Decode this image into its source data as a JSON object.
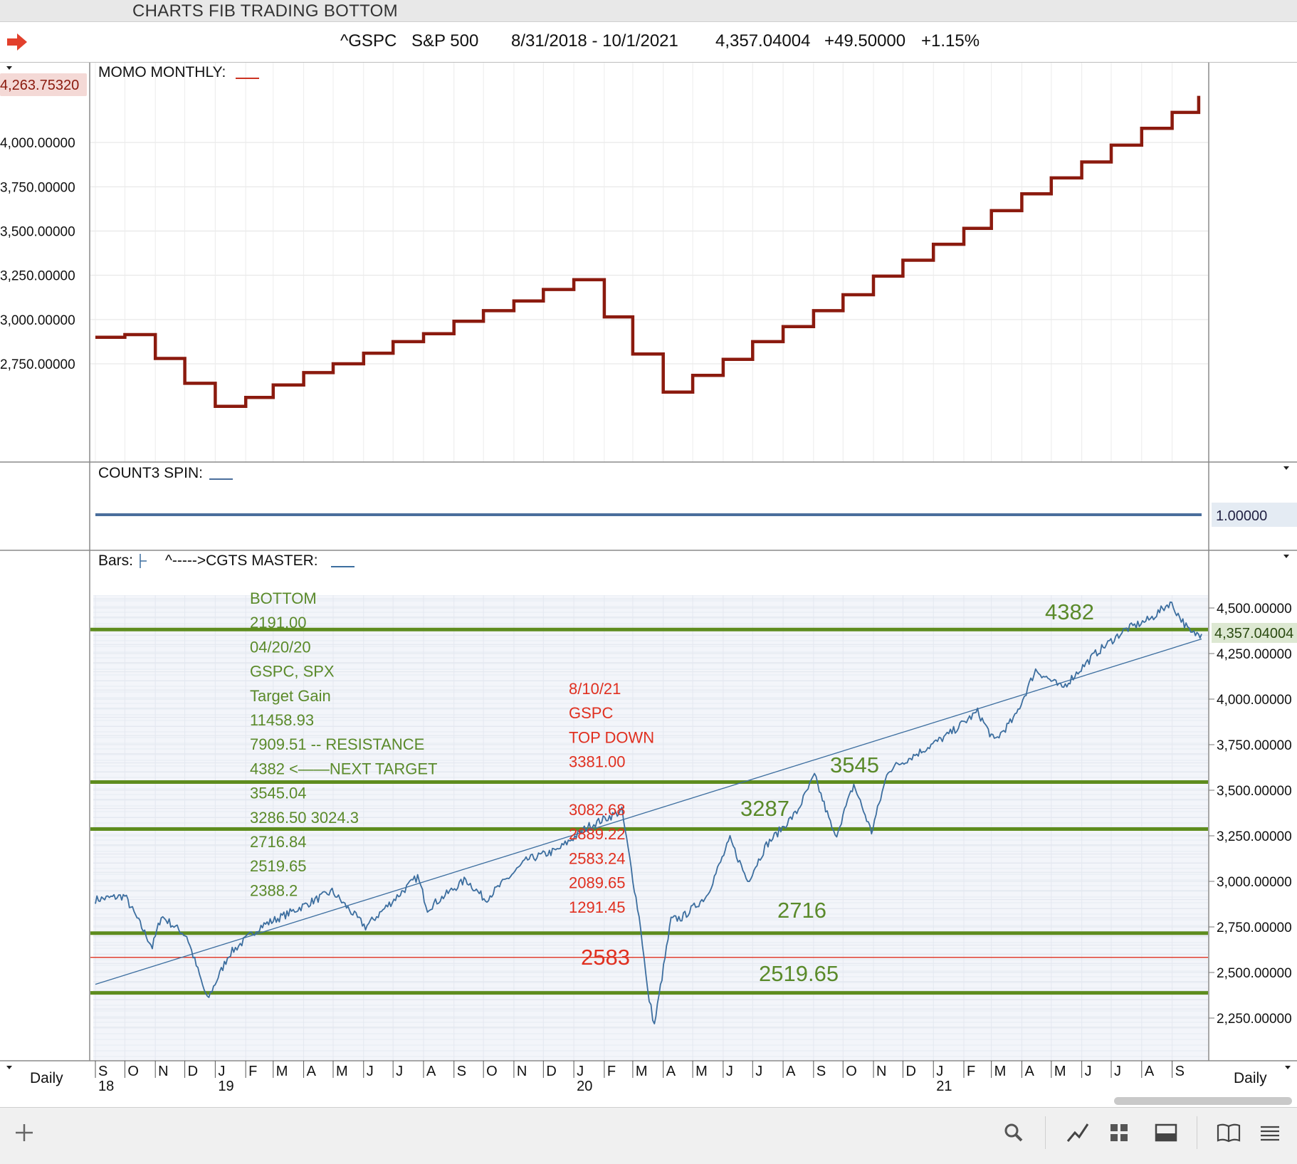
{
  "app_title": "CHARTS FIB TRADING BOTTOM",
  "header": {
    "symbol": "^GSPC",
    "name": "S&P 500",
    "date_range": "8/31/2018 - 10/1/2021",
    "last": "4,357.04004",
    "change": "+49.50000",
    "pct": "+1.15%"
  },
  "colors": {
    "momo_line": "#8b1a0e",
    "price_line": "#3c6e9f",
    "fib_lines": "#5e8c1e",
    "annotation_green": "#5a8a2a",
    "annotation_red": "#e03020",
    "spin_line": "#4a6e9c"
  },
  "panels": {
    "momo": {
      "label": "MOMO MONTHLY:",
      "current_label": "4,263.75320",
      "ticks": [
        "4,000.00000",
        "3,750.00000",
        "3,500.00000",
        "3,250.00000",
        "3,000.00000",
        "2,750.00000"
      ]
    },
    "count3": {
      "label": "COUNT3 SPIN:",
      "current_label": "1.00000"
    },
    "main": {
      "label_bars": "Bars:",
      "label_master": "^----->CGTS MASTER:",
      "ticks": [
        "4,500.00000",
        "4,250.00000",
        "4,000.00000",
        "3,750.00000",
        "3,500.00000",
        "3,250.00000",
        "3,000.00000",
        "2,750.00000",
        "2,500.00000",
        "2,250.00000"
      ],
      "current_label": "4,357.04004"
    }
  },
  "x_axis": {
    "months": [
      "S",
      "O",
      "N",
      "D",
      "J",
      "F",
      "M",
      "A",
      "M",
      "J",
      "J",
      "A",
      "S",
      "O",
      "N",
      "D",
      "J",
      "F",
      "M",
      "A",
      "M",
      "J",
      "J",
      "A",
      "S",
      "O",
      "N",
      "D",
      "J",
      "F",
      "M",
      "A",
      "M",
      "J",
      "J",
      "A",
      "S"
    ],
    "years": [
      {
        "label": "18",
        "index": 0
      },
      {
        "label": "19",
        "index": 4
      },
      {
        "label": "20",
        "index": 16
      },
      {
        "label": "21",
        "index": 28
      }
    ],
    "left_label": "Daily",
    "right_label": "Daily"
  },
  "notes_green": [
    "BOTTOM",
    "2191.00",
    "04/20/20",
    "GSPC, SPX",
    "Target Gain",
    "11458.93",
    "7909.51 -- RESISTANCE",
    "4382 <——NEXT TARGET",
    "3545.04",
    "3286.50 3024.3",
    "2716.84",
    "2519.65",
    "2388.2"
  ],
  "notes_red": [
    "8/10/21",
    "GSPC",
    "TOP DOWN",
    "3381.00"
  ],
  "notes_red2": [
    "3082.68",
    "2889.22",
    "2583.24",
    "2089.65",
    "1291.45"
  ],
  "fib_labels": {
    "l4382": "4382",
    "l3545": "3545",
    "l3287": "3287",
    "l2716": "2716",
    "l2519": "2519.65",
    "l2583": "2583"
  },
  "chart_data": [
    {
      "type": "line",
      "name": "MOMO MONTHLY",
      "step": true,
      "x": [
        "2018-09",
        "2018-10",
        "2018-11",
        "2018-12",
        "2019-01",
        "2019-02",
        "2019-03",
        "2019-04",
        "2019-05",
        "2019-06",
        "2019-07",
        "2019-08",
        "2019-09",
        "2019-10",
        "2019-11",
        "2019-12",
        "2020-01",
        "2020-02",
        "2020-03",
        "2020-04",
        "2020-05",
        "2020-06",
        "2020-07",
        "2020-08",
        "2020-09",
        "2020-10",
        "2020-11",
        "2020-12",
        "2021-01",
        "2021-02",
        "2021-03",
        "2021-04",
        "2021-05",
        "2021-06",
        "2021-07",
        "2021-08",
        "2021-09"
      ],
      "values": [
        2900,
        2915,
        2780,
        2640,
        2510,
        2560,
        2630,
        2700,
        2750,
        2810,
        2875,
        2920,
        2990,
        3050,
        3105,
        3170,
        3225,
        3015,
        2805,
        2590,
        2685,
        2775,
        2875,
        2960,
        3050,
        3140,
        3245,
        3335,
        3425,
        3515,
        3615,
        3710,
        3800,
        3890,
        3985,
        4080,
        4170
      ],
      "ylim": [
        2500,
        4300
      ],
      "last_value": 4263.7532
    },
    {
      "type": "line",
      "name": "COUNT3 SPIN",
      "values": [
        1,
        1
      ],
      "last_value": 1.0
    },
    {
      "type": "line",
      "name": "^GSPC",
      "x": [
        "2018-09-01",
        "2018-10-01",
        "2018-10-29",
        "2018-11-07",
        "2018-12-03",
        "2018-12-24",
        "2019-01-15",
        "2019-02-15",
        "2019-03-15",
        "2019-04-30",
        "2019-06-03",
        "2019-07-26",
        "2019-08-05",
        "2019-09-13",
        "2019-10-03",
        "2019-11-15",
        "2019-12-15",
        "2020-01-15",
        "2020-02-19",
        "2020-03-09",
        "2020-03-16",
        "2020-03-23",
        "2020-04-09",
        "2020-04-20",
        "2020-05-15",
        "2020-06-08",
        "2020-06-26",
        "2020-07-15",
        "2020-08-15",
        "2020-09-02",
        "2020-09-23",
        "2020-10-12",
        "2020-10-30",
        "2020-11-16",
        "2020-12-15",
        "2021-01-15",
        "2021-02-15",
        "2021-03-04",
        "2021-03-25",
        "2021-04-15",
        "2021-05-12",
        "2021-06-15",
        "2021-07-15",
        "2021-08-10",
        "2021-08-30",
        "2021-09-20",
        "2021-10-01"
      ],
      "values": [
        2900,
        2920,
        2640,
        2810,
        2700,
        2350,
        2600,
        2750,
        2820,
        2945,
        2750,
        3025,
        2850,
        3010,
        2900,
        3120,
        3170,
        3300,
        3386,
        2750,
        2400,
        2210,
        2790,
        2800,
        2920,
        3230,
        3000,
        3200,
        3380,
        3580,
        3240,
        3530,
        3270,
        3610,
        3700,
        3800,
        3930,
        3770,
        3900,
        4160,
        4060,
        4250,
        4380,
        4440,
        4530,
        4360,
        4357
      ],
      "ylim": [
        2150,
        4560
      ],
      "last_value": 4357.04004,
      "fib_levels": [
        4382,
        3545,
        3287,
        2716,
        2583,
        2388
      ],
      "trendline": [
        [
          "2018-09-01",
          2435
        ],
        [
          "2021-10-01",
          4330
        ]
      ]
    }
  ]
}
